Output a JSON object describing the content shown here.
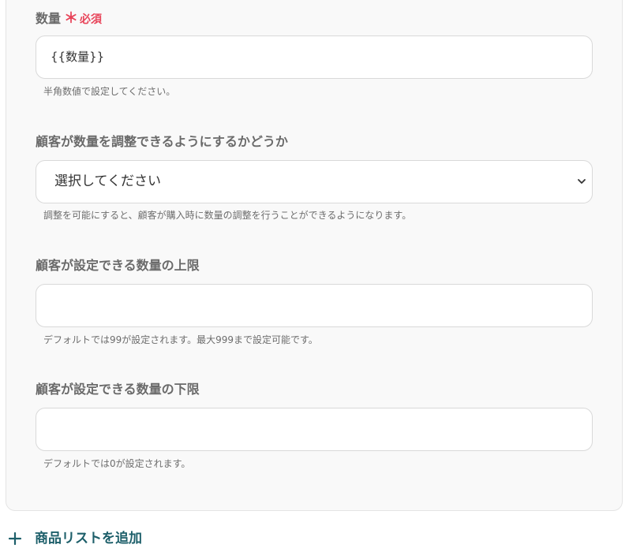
{
  "quantity": {
    "label": "数量",
    "required_mark": "＊",
    "required_text": "必須",
    "value": "{{数量}}",
    "help": "半角数値で設定してください。"
  },
  "adjustable": {
    "label": "顧客が数量を調整できるようにするかどうか",
    "selected": "選択してください",
    "help": "調整を可能にすると、顧客が購入時に数量の調整を行うことができるようになります。"
  },
  "max": {
    "label": "顧客が設定できる数量の上限",
    "value": "",
    "help": "デフォルトでは99が設定されます。最大999まで設定可能です。"
  },
  "min": {
    "label": "顧客が設定できる数量の下限",
    "value": "",
    "help": "デフォルトでは0が設定されます。"
  },
  "add_button": {
    "label": "商品リストを追加",
    "icon": "plus-icon"
  },
  "colors": {
    "required": "#e8455a",
    "accent": "#1d5f6a"
  }
}
